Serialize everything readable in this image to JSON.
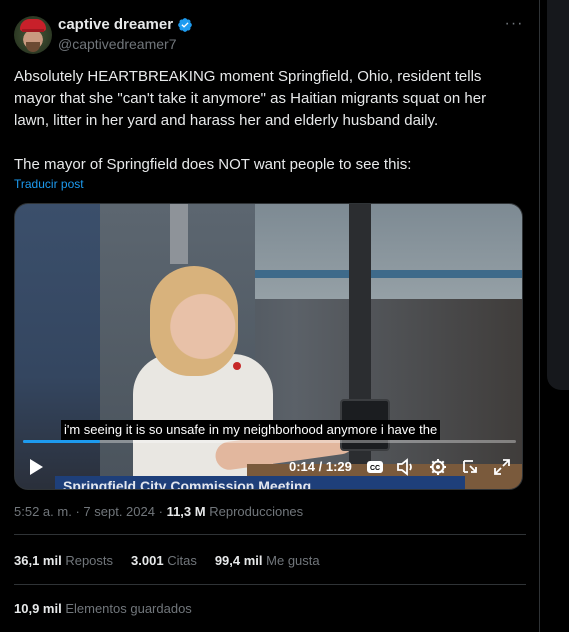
{
  "author": {
    "name": "captive dreamer",
    "handle": "@captivedreamer7"
  },
  "more_label": "···",
  "tweet": {
    "text": "Absolutely HEARTBREAKING moment Springfield, Ohio, resident tells mayor that she \"can't take it anymore\" as Haitian migrants squat on her lawn, litter in her yard and harass her and elderly husband daily.\n\nThe mayor of Springfield does NOT want people to see this:",
    "translate_label": "Traducir post"
  },
  "video": {
    "caption": "i'm seeing it is so unsafe in my neighborhood anymore i have the",
    "banner_text": "Springfield City Commission Meeting",
    "time": "0:14 / 1:29",
    "progress": 0.157
  },
  "meta": {
    "time": "5:52 a. m.",
    "separator": "·",
    "date": "7 sept. 2024",
    "views_count": "11,3 M",
    "views_label": "Reproducciones"
  },
  "stats": {
    "reposts_count": "36,1 mil",
    "reposts_label": "Reposts",
    "quotes_count": "3.001",
    "quotes_label": "Citas",
    "likes_count": "99,4 mil",
    "likes_label": "Me gusta",
    "bookmarks_count": "10,9 mil",
    "bookmarks_label": "Elementos guardados"
  },
  "colors": {
    "accent": "#1d9bf0",
    "secondary_text": "#71767b",
    "primary_text": "#e7e9ea",
    "background": "#000000"
  }
}
